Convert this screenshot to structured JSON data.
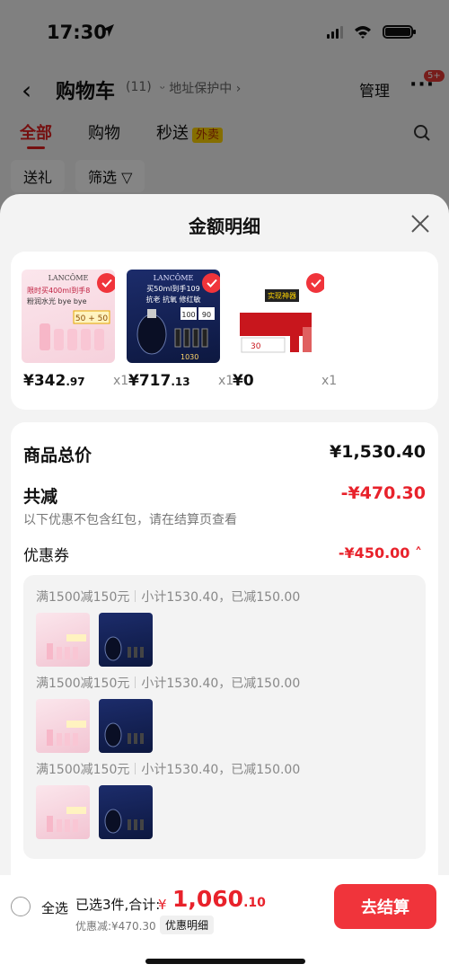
{
  "status_bar": {
    "time": "17:30"
  },
  "nav": {
    "title": "购物车",
    "count": "(11)",
    "address": "地址保护中",
    "manage": "管理",
    "more": "···",
    "badge": "5+"
  },
  "tabs": [
    {
      "label": "全部"
    },
    {
      "label": "购物"
    },
    {
      "label": "秒送",
      "tag": "外卖"
    }
  ],
  "chips": [
    {
      "label": "送礼"
    },
    {
      "label": "筛选"
    }
  ],
  "sheet": {
    "title": "金额明细",
    "products": [
      {
        "price_main": "¥342",
        "price_decimal": ".97",
        "qty": "x1"
      },
      {
        "price_main": "¥717",
        "price_decimal": ".13",
        "qty": "x1"
      },
      {
        "price_main": "¥0",
        "price_decimal": "",
        "qty": "x1"
      }
    ],
    "product_images": {
      "p1": {
        "brand": "LANCÔME",
        "line1": "限时买400ml到手8",
        "line2": "粉润水光 bye bye",
        "tag": "50 + 50"
      },
      "p2": {
        "brand": "LANCÔME",
        "line1": "买50ml到手109",
        "line2": "抗老 抗氧 修红敏",
        "tag1": "100",
        "tag2": "90",
        "note": "1030"
      },
      "p3": {
        "title": "实现神器",
        "label": "30"
      }
    },
    "summary": {
      "goods_total_label": "商品总价",
      "goods_total_value": "¥1,530.40",
      "reduction_label": "共减",
      "reduction_value": "-¥470.30",
      "note": "以下优惠不包含红包，请在结算页查看",
      "coupon_label": "优惠券",
      "coupon_value": "-¥450.00"
    },
    "coupon_groups": [
      {
        "rule": "满1500减150元",
        "detail": "小计1530.40，已减150.00"
      },
      {
        "rule": "满1500减150元",
        "detail": "小计1530.40，已减150.00"
      },
      {
        "rule": "满1500减150元",
        "detail": "小计1530.40，已减150.00"
      }
    ]
  },
  "bottom": {
    "select_all": "全选",
    "selected_count": "已选3件,合计:",
    "currency": "¥",
    "total_main": "1,060",
    "total_decimal": ".10",
    "discount_text": "优惠减:¥470.30",
    "detail_button": "优惠明细",
    "checkout": "去结算"
  },
  "colors": {
    "accent": "#f0343b",
    "price_red": "#e8222b"
  }
}
